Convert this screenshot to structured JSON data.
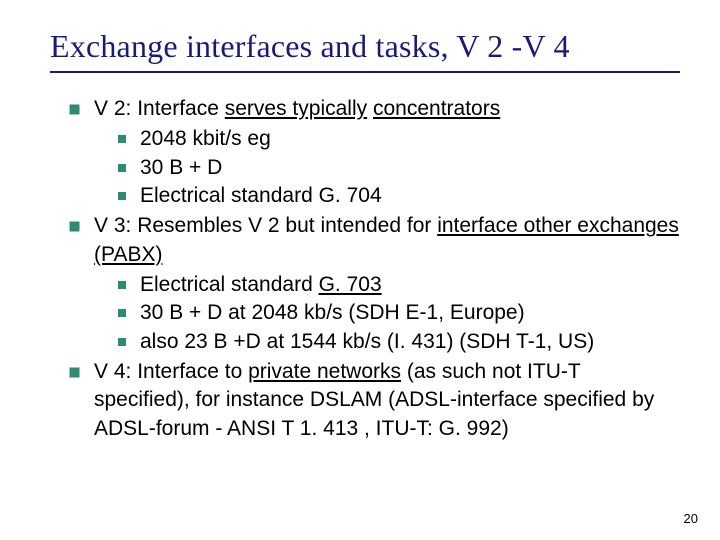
{
  "title": "Exchange interfaces and tasks, V 2 -V 4",
  "bullets": [
    {
      "runs": [
        {
          "t": "V 2: Interface "
        },
        {
          "t": "serves typically",
          "u": true
        },
        {
          "t": " "
        },
        {
          "t": "concentrators",
          "u": true
        }
      ],
      "sub": [
        {
          "runs": [
            {
              "t": "2048 kbit/s eg"
            }
          ]
        },
        {
          "runs": [
            {
              "t": "30 B + D"
            }
          ]
        },
        {
          "runs": [
            {
              "t": "Electrical standard G. 704"
            }
          ]
        }
      ]
    },
    {
      "runs": [
        {
          "t": "V 3: Resembles V 2 but intended for "
        },
        {
          "t": "interface other exchanges (PABX)",
          "u": true
        }
      ],
      "sub": [
        {
          "runs": [
            {
              "t": "Electrical standard "
            },
            {
              "t": "G. 703",
              "u": true
            }
          ]
        },
        {
          "runs": [
            {
              "t": "30 B + D at 2048 kb/s (SDH E-1, Europe)"
            }
          ]
        },
        {
          "runs": [
            {
              "t": "also 23 B +D at 1544 kb/s (I. 431) (SDH T-1, US)"
            }
          ]
        }
      ]
    },
    {
      "runs": [
        {
          "t": "V 4: Interface to "
        },
        {
          "t": "private networks",
          "u": true
        },
        {
          "t": " (as such not ITU-T specified), for instance DSLAM (ADSL-interface specified by ADSL-forum - ANSI T 1. 413 , ITU-T: G. 992)"
        }
      ],
      "sub": []
    }
  ],
  "page_number": "20"
}
